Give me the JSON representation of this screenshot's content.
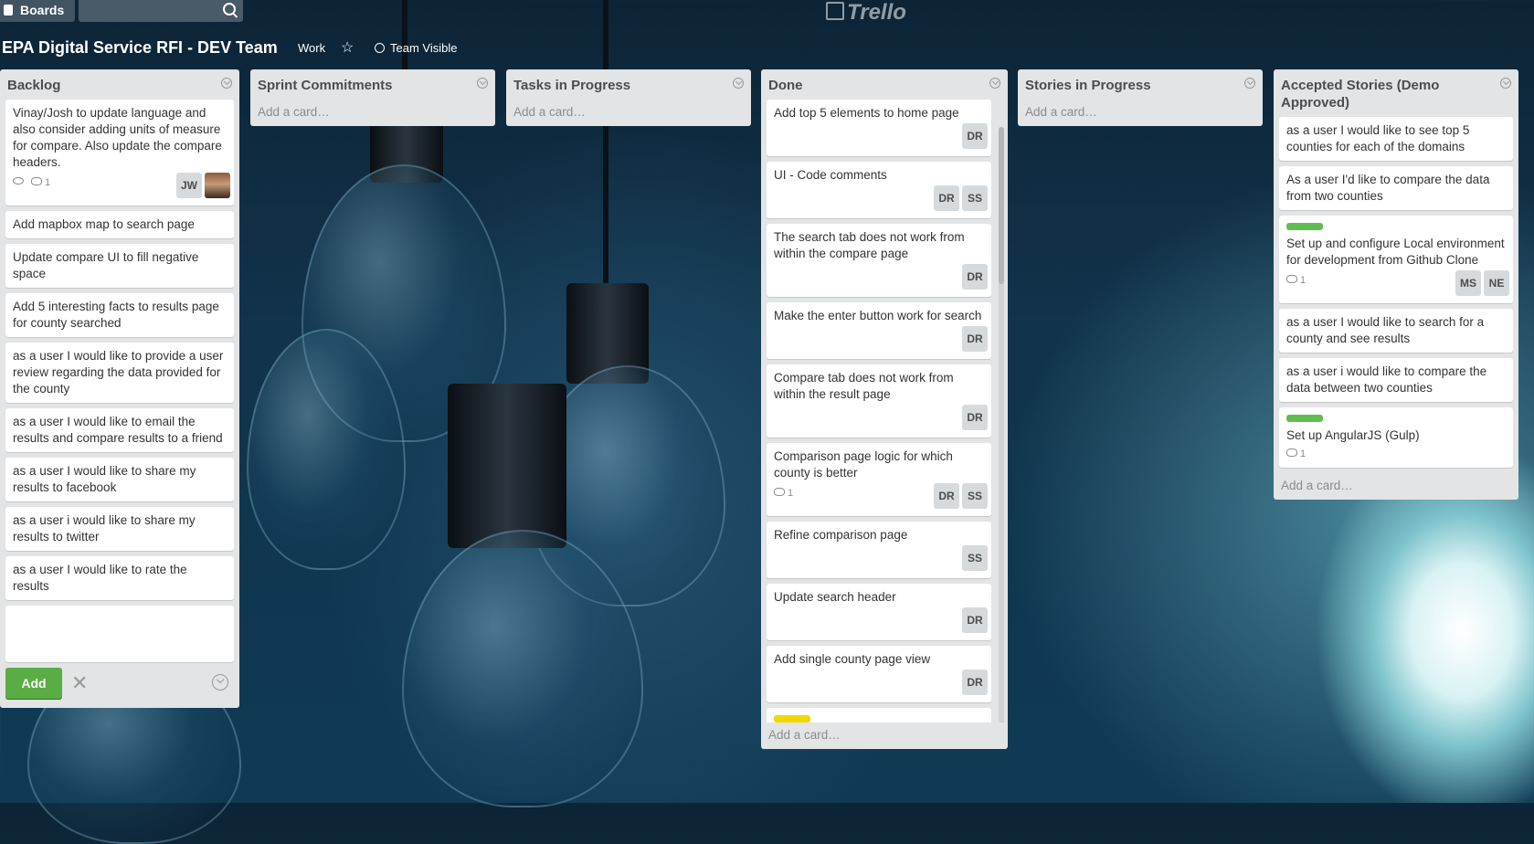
{
  "topbar": {
    "boards_label": "Boards",
    "logo_text": "Trello"
  },
  "board": {
    "title": "EPA Digital Service RFI - DEV Team",
    "org": "Work",
    "visibility": "Team Visible"
  },
  "add_card_label": "Add a card…",
  "lists": {
    "backlog": {
      "title": "Backlog",
      "cards": [
        {
          "text": "Vinay/Josh to update language and also consider adding units of measure for compare. Also update the compare headers.",
          "comments": "1",
          "members": [
            "JW"
          ]
        },
        {
          "text": "Add mapbox map to search page"
        },
        {
          "text": "Update compare UI to fill negative space"
        },
        {
          "text": "Add 5 interesting facts to results page for county searched"
        },
        {
          "text": "as a user I would like to provide a user review regarding the data provided for the county"
        },
        {
          "text": "as a user I would like to email the results and compare results to a friend"
        },
        {
          "text": "as a user I would like to share my results to facebook"
        },
        {
          "text": "as a user i would like to share my results to twitter"
        },
        {
          "text": "as a user I would like to rate the results"
        }
      ],
      "composer_add": "Add"
    },
    "sprint": {
      "title": "Sprint Commitments"
    },
    "tasks": {
      "title": "Tasks in Progress"
    },
    "done": {
      "title": "Done",
      "cards": [
        {
          "text": "Add top 5 elements to home page",
          "members": [
            "DR"
          ]
        },
        {
          "text": "UI - Code comments",
          "members": [
            "DR",
            "SS"
          ]
        },
        {
          "text": "The search tab does not work from within the compare page",
          "members": [
            "DR"
          ]
        },
        {
          "text": "Make the enter button work for search",
          "members": [
            "DR"
          ]
        },
        {
          "text": "Compare tab does not work from within the result page",
          "members": [
            "DR"
          ]
        },
        {
          "text": "Comparison page logic for which county is better",
          "comments": "1",
          "members": [
            "DR",
            "SS"
          ]
        },
        {
          "text": "Refine comparison page",
          "members": [
            "SS"
          ]
        },
        {
          "text": "Update search header",
          "members": [
            "DR"
          ]
        },
        {
          "text": "Add single county page view",
          "members": [
            "DR"
          ]
        }
      ]
    },
    "stories": {
      "title": "Stories in Progress"
    },
    "accepted": {
      "title": "Accepted Stories (Demo Approved)",
      "cards": [
        {
          "text": "as a user I would like to see top 5 counties for each of the domains"
        },
        {
          "text": "As a user I'd like to compare the data from two counties"
        },
        {
          "text": "Set up and configure Local environment for development from Github Clone",
          "label": "#61bd4f",
          "comments": "1",
          "members": [
            "MS",
            "NE"
          ]
        },
        {
          "text": "as a user I would like to search for a county and see results"
        },
        {
          "text": "as a user i would like to compare the data between two counties"
        },
        {
          "text": "Set up AngularJS (Gulp)",
          "label": "#61bd4f",
          "comments": "1"
        }
      ]
    }
  },
  "colors": {
    "label_green": "#61bd4f",
    "label_yellow": "#f2d600",
    "add_button": "#5aac44"
  }
}
